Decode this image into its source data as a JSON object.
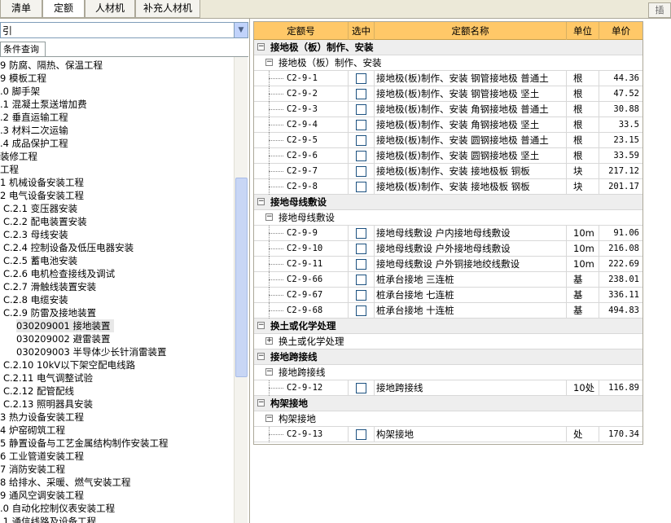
{
  "tabs": [
    "清单",
    "定额",
    "人材机",
    "补充人材机"
  ],
  "insert_label": "插",
  "left": {
    "select_value": "引",
    "cond_tab": "条件查询",
    "tree": [
      {
        "text": "9 防腐、隔热、保温工程"
      },
      {
        "text": "9 模板工程"
      },
      {
        "text": ".0 脚手架"
      },
      {
        "text": ".1 混凝土泵送增加费"
      },
      {
        "text": ".2 垂直运输工程"
      },
      {
        "text": ".3 材料二次运输"
      },
      {
        "text": ".4 成品保护工程"
      },
      {
        "text": "装修工程"
      },
      {
        "text": "工程"
      },
      {
        "text": "1 机械设备安装工程"
      },
      {
        "text": "2 电气设备安装工程"
      },
      {
        "text": "C.2.1 变压器安装"
      },
      {
        "text": "C.2.2 配电装置安装"
      },
      {
        "text": "C.2.3 母线安装"
      },
      {
        "text": "C.2.4 控制设备及低压电器安装"
      },
      {
        "text": "C.2.5 蓄电池安装"
      },
      {
        "text": "C.2.6 电机检查接线及调试"
      },
      {
        "text": "C.2.7 滑触线装置安装"
      },
      {
        "text": "C.2.8 电缆安装"
      },
      {
        "text": "C.2.9 防雷及接地装置"
      },
      {
        "text": "030209001 接地装置"
      },
      {
        "text": "030209002 避雷装置"
      },
      {
        "text": "030209003 半导体少长针消雷装置"
      },
      {
        "text": "C.2.10 10kV以下架空配电线路"
      },
      {
        "text": "C.2.11 电气调整试验"
      },
      {
        "text": "C.2.12 配管配线"
      },
      {
        "text": "C.2.13 照明器具安装"
      },
      {
        "text": "3 热力设备安装工程"
      },
      {
        "text": "4 炉窑砌筑工程"
      },
      {
        "text": "5 静置设备与工艺金属结构制作安装工程"
      },
      {
        "text": "6 工业管道安装工程"
      },
      {
        "text": "7 消防安装工程"
      },
      {
        "text": "8 给排水、采暖、燃气安装工程"
      },
      {
        "text": "9 通风空调安装工程"
      },
      {
        "text": ".0 自动化控制仪表安装工程"
      },
      {
        "text": ".1 通信线路及设备工程"
      }
    ]
  },
  "grid": {
    "headers": [
      "定额号",
      "选中",
      "定额名称",
      "单位",
      "单价"
    ],
    "rows": [
      {
        "type": "group",
        "title": "接地极（板）制作、安装"
      },
      {
        "type": "sub",
        "title": "接地极（板）制作、安装",
        "exp": "−"
      },
      {
        "type": "item",
        "code": "C2-9-1",
        "name": "接地极(板)制作、安装 钢管接地极 普通土",
        "unit": "根",
        "price": "44.36"
      },
      {
        "type": "item",
        "code": "C2-9-2",
        "name": "接地极(板)制作、安装 钢管接地极 坚土",
        "unit": "根",
        "price": "47.52"
      },
      {
        "type": "item",
        "code": "C2-9-3",
        "name": "接地极(板)制作、安装 角钢接地极 普通土",
        "unit": "根",
        "price": "30.88"
      },
      {
        "type": "item",
        "code": "C2-9-4",
        "name": "接地极(板)制作、安装 角钢接地极 坚土",
        "unit": "根",
        "price": "33.5"
      },
      {
        "type": "item",
        "code": "C2-9-5",
        "name": "接地极(板)制作、安装 圆钢接地极 普通土",
        "unit": "根",
        "price": "23.15"
      },
      {
        "type": "item",
        "code": "C2-9-6",
        "name": "接地极(板)制作、安装 圆钢接地极 坚土",
        "unit": "根",
        "price": "33.59"
      },
      {
        "type": "item",
        "code": "C2-9-7",
        "name": "接地极(板)制作、安装 接地极板 铜板",
        "unit": "块",
        "price": "217.12"
      },
      {
        "type": "item",
        "code": "C2-9-8",
        "name": "接地极(板)制作、安装 接地极板 钢板",
        "unit": "块",
        "price": "201.17"
      },
      {
        "type": "group",
        "title": "接地母线敷设"
      },
      {
        "type": "sub",
        "title": "接地母线敷设",
        "exp": "−"
      },
      {
        "type": "item",
        "code": "C2-9-9",
        "name": "接地母线敷设 户内接地母线敷设",
        "unit": "10m",
        "price": "91.06"
      },
      {
        "type": "item",
        "code": "C2-9-10",
        "name": "接地母线敷设 户外接地母线敷设",
        "unit": "10m",
        "price": "216.08"
      },
      {
        "type": "item",
        "code": "C2-9-11",
        "name": "接地母线敷设 户外铜接地绞线敷设",
        "unit": "10m",
        "price": "222.69"
      },
      {
        "type": "item",
        "code": "C2-9-66",
        "name": "桩承台接地 三连桩",
        "unit": "基",
        "price": "238.01"
      },
      {
        "type": "item",
        "code": "C2-9-67",
        "name": "桩承台接地 七连桩",
        "unit": "基",
        "price": "336.11"
      },
      {
        "type": "item",
        "code": "C2-9-68",
        "name": "桩承台接地 十连桩",
        "unit": "基",
        "price": "494.83"
      },
      {
        "type": "group",
        "title": "换土或化学处理"
      },
      {
        "type": "sub",
        "title": "换土或化学处理",
        "exp": "+"
      },
      {
        "type": "group",
        "title": "接地跨接线"
      },
      {
        "type": "sub",
        "title": "接地跨接线",
        "exp": "−"
      },
      {
        "type": "item",
        "code": "C2-9-12",
        "name": "接地跨接线",
        "unit": "10处",
        "price": "116.89"
      },
      {
        "type": "group",
        "title": "构架接地"
      },
      {
        "type": "sub",
        "title": "构架接地",
        "exp": "−"
      },
      {
        "type": "item",
        "code": "C2-9-13",
        "name": "构架接地",
        "unit": "处",
        "price": "170.34"
      }
    ]
  }
}
